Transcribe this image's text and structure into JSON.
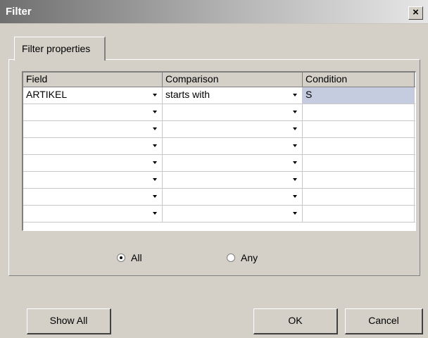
{
  "window": {
    "title": "Filter",
    "close_symbol": "×"
  },
  "tab": {
    "label": "Filter properties"
  },
  "grid": {
    "headers": [
      "Field",
      "Comparison",
      "Condition"
    ],
    "rows": [
      {
        "field": "ARTIKEL",
        "comparison": "starts with",
        "condition": "S"
      },
      {
        "field": "",
        "comparison": "",
        "condition": ""
      },
      {
        "field": "",
        "comparison": "",
        "condition": ""
      },
      {
        "field": "",
        "comparison": "",
        "condition": ""
      },
      {
        "field": "",
        "comparison": "",
        "condition": ""
      },
      {
        "field": "",
        "comparison": "",
        "condition": ""
      },
      {
        "field": "",
        "comparison": "",
        "condition": ""
      },
      {
        "field": "",
        "comparison": "",
        "condition": ""
      }
    ]
  },
  "match": {
    "options": [
      {
        "label": "All",
        "checked": true
      },
      {
        "label": "Any",
        "checked": false
      }
    ]
  },
  "buttons": {
    "show_all": "Show All",
    "ok": "OK",
    "cancel": "Cancel"
  }
}
